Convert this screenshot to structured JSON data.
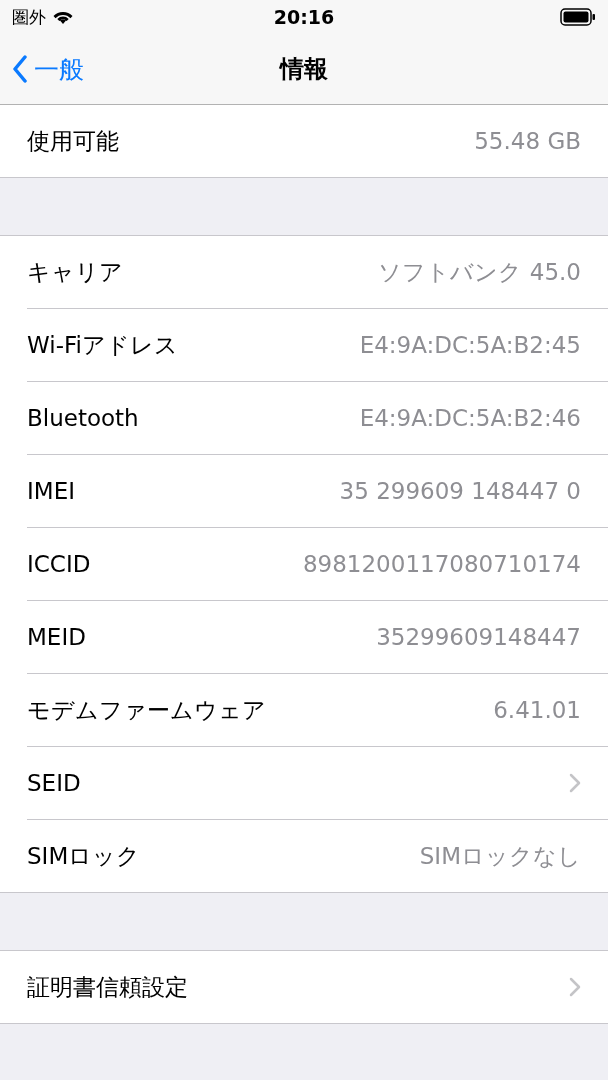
{
  "status_bar": {
    "carrier": "圏外",
    "time": "20:16"
  },
  "nav": {
    "back": "一般",
    "title": "情報"
  },
  "groups": [
    {
      "rows": [
        {
          "kind": "value",
          "label": "使用可能",
          "value": "55.48 GB"
        }
      ]
    },
    {
      "rows": [
        {
          "kind": "value",
          "label": "キャリア",
          "value": "ソフトバンク 45.0"
        },
        {
          "kind": "value",
          "label": "Wi-Fiアドレス",
          "value": "E4:9A:DC:5A:B2:45"
        },
        {
          "kind": "value",
          "label": "Bluetooth",
          "value": "E4:9A:DC:5A:B2:46"
        },
        {
          "kind": "value",
          "label": "IMEI",
          "value": "35 299609 148447 0"
        },
        {
          "kind": "value",
          "label": "ICCID",
          "value": "8981200117080710174"
        },
        {
          "kind": "value",
          "label": "MEID",
          "value": "35299609148447"
        },
        {
          "kind": "value",
          "label": "モデムファームウェア",
          "value": "6.41.01"
        },
        {
          "kind": "disclosure",
          "label": "SEID"
        },
        {
          "kind": "value",
          "label": "SIMロック",
          "value": "SIMロックなし"
        }
      ]
    },
    {
      "rows": [
        {
          "kind": "disclosure",
          "label": "証明書信頼設定"
        }
      ]
    }
  ]
}
